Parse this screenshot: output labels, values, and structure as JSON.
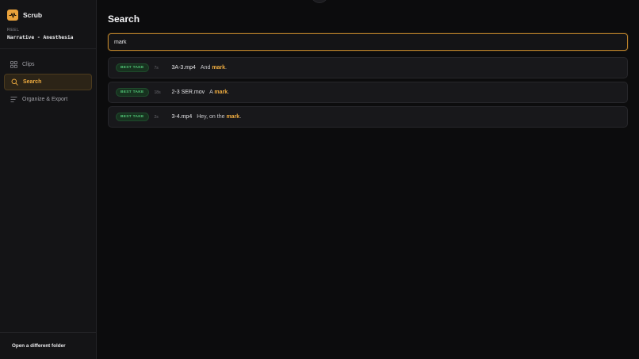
{
  "app": {
    "name": "Scrub"
  },
  "reel": {
    "label": "REEL",
    "name": "Narrative - Anesthesia"
  },
  "nav": [
    {
      "label": "Clips",
      "icon": "grid-icon",
      "active": false
    },
    {
      "label": "Search",
      "icon": "search-icon",
      "active": true
    },
    {
      "label": "Organize & Export",
      "icon": "list-icon",
      "active": false
    }
  ],
  "sidebar_footer": {
    "open_folder_label": "Open a different folder"
  },
  "main": {
    "title": "Search",
    "search": {
      "value": "mark",
      "placeholder": ""
    }
  },
  "results": [
    {
      "badge": "BEST TAKE",
      "duration": "7s",
      "filename": "3A-3.mp4",
      "text_before": "And",
      "match": "mark",
      "text_after": "."
    },
    {
      "badge": "BEST TAKE",
      "duration": "18s",
      "filename": "2-3 SER.mov",
      "text_before": "A",
      "match": "mark",
      "text_after": "."
    },
    {
      "badge": "BEST TAKE",
      "duration": "2s",
      "filename": "3-4.mp4",
      "text_before": "Hey, on the",
      "match": "mark",
      "text_after": "."
    }
  ],
  "colors": {
    "accent": "#efac40",
    "background": "#0c0c0d",
    "sidebar": "#141416",
    "badge_bg": "#17321f",
    "badge_text": "#52c778"
  }
}
